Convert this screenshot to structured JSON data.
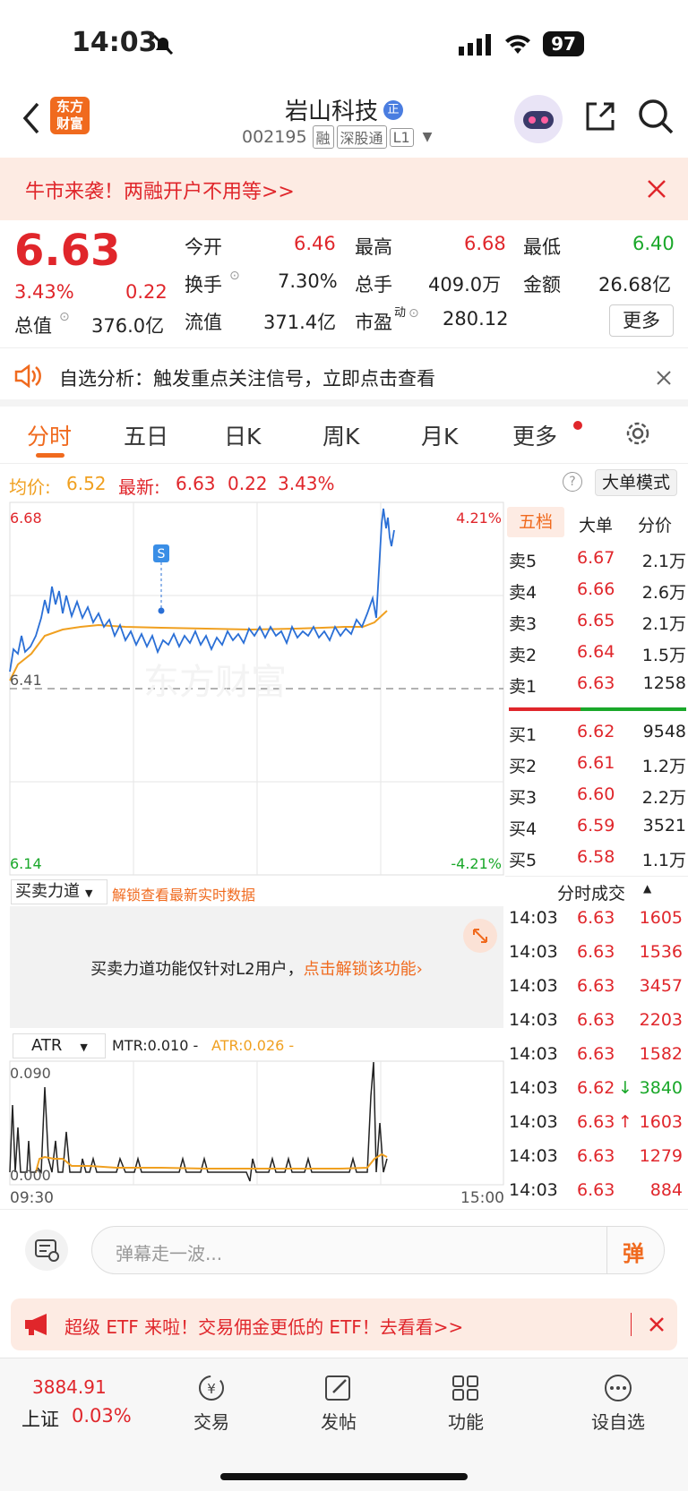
{
  "status_bar": {
    "time": "14:03",
    "battery": "97"
  },
  "header": {
    "title": "岩山科技",
    "title_badge": "正",
    "code": "002195",
    "tags": [
      "融",
      "深股通",
      "L1"
    ]
  },
  "promo_banner": {
    "text": "牛市来袭！两融开户不用等>>"
  },
  "quote": {
    "price": "6.63",
    "change_pct": "3.43%",
    "change": "0.22",
    "open_label": "今开",
    "open": "6.46",
    "high_label": "最高",
    "high": "6.68",
    "low_label": "最低",
    "low": "6.40",
    "turnover_label": "换手",
    "turnover": "7.30%",
    "volume_label": "总手",
    "volume": "409.0万",
    "amount_label": "金额",
    "amount": "26.68亿",
    "mktcap_label": "总值",
    "mktcap": "376.0亿",
    "float_label": "流值",
    "float": "371.4亿",
    "pe_label": "市盈",
    "pe_sup": "动",
    "pe": "280.12",
    "more_button": "更多"
  },
  "tip": {
    "text": "自选分析：触发重点关注信号，立即点击查看"
  },
  "tabs": [
    "分时",
    "五日",
    "日K",
    "周K",
    "月K",
    "更多"
  ],
  "chart_header": {
    "avg_label": "均价:",
    "avg": "6.52",
    "last_label": "最新:",
    "last": "6.63",
    "chg": "0.22",
    "pct": "3.43%",
    "mode_button": "大单模式"
  },
  "chart_labels": {
    "top_price": "6.68",
    "bottom_price": "6.14",
    "top_pct": "4.21%",
    "bottom_pct": "-4.21%",
    "prev_close": "6.41",
    "marker": "S",
    "watermark": "东方财富"
  },
  "book_tabs": [
    "五档",
    "大单",
    "分价"
  ],
  "asks": [
    {
      "label": "卖5",
      "price": "6.67",
      "vol": "2.1万"
    },
    {
      "label": "卖4",
      "price": "6.66",
      "vol": "2.6万"
    },
    {
      "label": "卖3",
      "price": "6.65",
      "vol": "2.1万"
    },
    {
      "label": "卖2",
      "price": "6.64",
      "vol": "1.5万"
    },
    {
      "label": "卖1",
      "price": "6.63",
      "vol": "1258"
    }
  ],
  "bids": [
    {
      "label": "买1",
      "price": "6.62",
      "vol": "9548"
    },
    {
      "label": "买2",
      "price": "6.61",
      "vol": "1.2万"
    },
    {
      "label": "买3",
      "price": "6.60",
      "vol": "2.2万"
    },
    {
      "label": "买4",
      "price": "6.59",
      "vol": "3521"
    },
    {
      "label": "买5",
      "price": "6.58",
      "vol": "1.1万"
    }
  ],
  "ticks_header": "分时成交",
  "ticks": [
    {
      "time": "14:03",
      "price": "6.63",
      "vol": "1605",
      "arrow": ""
    },
    {
      "time": "14:03",
      "price": "6.63",
      "vol": "1536",
      "arrow": ""
    },
    {
      "time": "14:03",
      "price": "6.63",
      "vol": "3457",
      "arrow": ""
    },
    {
      "time": "14:03",
      "price": "6.63",
      "vol": "2203",
      "arrow": ""
    },
    {
      "time": "14:03",
      "price": "6.63",
      "vol": "1582",
      "arrow": ""
    },
    {
      "time": "14:03",
      "price": "6.62",
      "vol": "3840",
      "arrow": "↓"
    },
    {
      "time": "14:03",
      "price": "6.63",
      "vol": "1603",
      "arrow": "↑"
    },
    {
      "time": "14:03",
      "price": "6.63",
      "vol": "1279",
      "arrow": ""
    },
    {
      "time": "14:03",
      "price": "6.63",
      "vol": "884",
      "arrow": ""
    }
  ],
  "force": {
    "selector": "买卖力道",
    "unlock": "解锁查看最新实时数据",
    "msg": "买卖力道功能仅针对L2用户，",
    "link": "点击解锁该功能"
  },
  "atr": {
    "selector": "ATR",
    "mtr": "MTR:0.010 -",
    "atr": "ATR:0.026 -",
    "top": "0.090",
    "bottom": "0.000",
    "start": "09:30",
    "end": "15:00"
  },
  "comment": {
    "placeholder": "弹幕走一波...",
    "send": "弹"
  },
  "etf_banner": {
    "text": "超级 ETF 来啦！交易佣金更低的 ETF！去看看>>"
  },
  "bottom_nav": {
    "index_value": "3884.91",
    "index_name": "上证",
    "index_pct": "0.03%",
    "items": [
      "交易",
      "发帖",
      "功能",
      "设自选"
    ]
  },
  "colors": {
    "up": "#e0262b",
    "down": "#1aa82a",
    "accent": "#f06a1e",
    "avg_line": "#f0a020",
    "price_line": "#2a6fd6"
  }
}
